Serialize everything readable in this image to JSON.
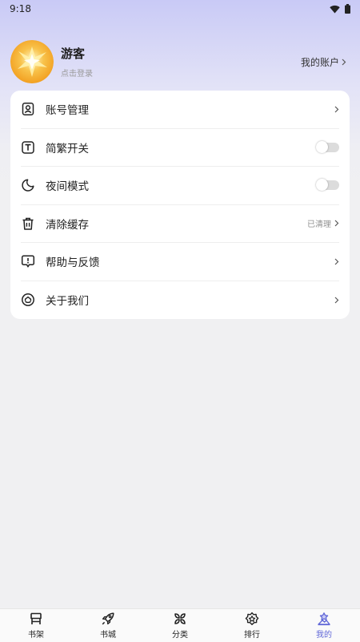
{
  "status_bar": {
    "time": "9:18",
    "icons": [
      "wifi-icon",
      "battery-icon"
    ]
  },
  "profile": {
    "name": "游客",
    "hint": "点击登录",
    "account_link": "我的账户"
  },
  "menu": {
    "items": [
      {
        "label": "账号管理",
        "icon": "account-icon",
        "right": "chevron"
      },
      {
        "label": "简繁开关",
        "icon": "text-t-icon",
        "right": "toggle",
        "on": false
      },
      {
        "label": "夜间模式",
        "icon": "moon-icon",
        "right": "toggle",
        "on": false
      },
      {
        "label": "清除缓存",
        "icon": "trash-icon",
        "right": "chevron",
        "value": "已清理"
      },
      {
        "label": "帮助与反馈",
        "icon": "feedback-icon",
        "right": "chevron"
      },
      {
        "label": "关于我们",
        "icon": "about-icon",
        "right": "chevron"
      }
    ]
  },
  "tabs": [
    {
      "label": "书架",
      "icon": "bookshelf-icon"
    },
    {
      "label": "书城",
      "icon": "rocket-icon"
    },
    {
      "label": "分类",
      "icon": "category-icon"
    },
    {
      "label": "排行",
      "icon": "ranking-icon"
    },
    {
      "label": "我的",
      "icon": "mine-icon",
      "active": true
    }
  ],
  "colors": {
    "accent": "#6168d8",
    "header_gradient_top": "#c9caf6",
    "background": "#f0f0f2"
  }
}
